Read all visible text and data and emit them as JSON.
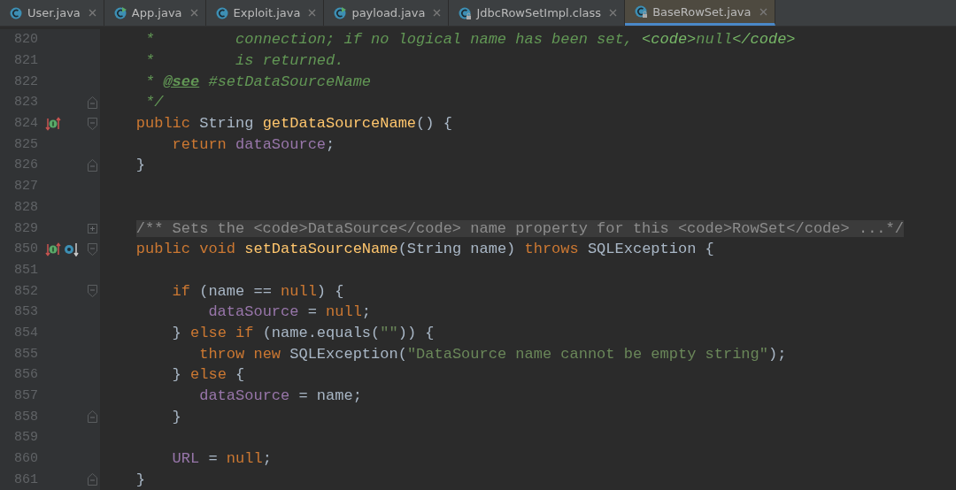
{
  "tabs": [
    {
      "label": "User.java",
      "kind": "class",
      "selected": false
    },
    {
      "label": "App.java",
      "kind": "runnable",
      "selected": false
    },
    {
      "label": "Exploit.java",
      "kind": "class",
      "selected": false
    },
    {
      "label": "payload.java",
      "kind": "runnable",
      "selected": false
    },
    {
      "label": "JdbcRowSetImpl.class",
      "kind": "compiled",
      "selected": false
    },
    {
      "label": "BaseRowSet.java",
      "kind": "compiled",
      "selected": true
    }
  ],
  "lines": [
    {
      "number": "820",
      "tokens": [
        {
          "kind": "doc",
          "text": "     *         connection; if no logical name has been set, "
        },
        {
          "kind": "tag",
          "text": "<code>"
        },
        {
          "kind": "doc",
          "text": "null"
        },
        {
          "kind": "tag",
          "text": "</code>"
        }
      ]
    },
    {
      "number": "821",
      "tokens": [
        {
          "kind": "doc",
          "text": "     *         is returned."
        }
      ]
    },
    {
      "number": "822",
      "tokens": [
        {
          "kind": "doc",
          "text": "     * "
        },
        {
          "kind": "doctag",
          "text": "@see"
        },
        {
          "kind": "doc",
          "text": " #setDataSourceName"
        }
      ]
    },
    {
      "number": "823",
      "fold": {
        "kind": "end"
      },
      "tokens": [
        {
          "kind": "doc",
          "text": "     */"
        }
      ]
    },
    {
      "number": "824",
      "fold": {
        "kind": "start"
      },
      "markers": [
        {
          "kind": "overrides"
        }
      ],
      "tokens": [
        {
          "kind": "kw",
          "text": "    public "
        },
        {
          "kind": "plain",
          "text": "String "
        },
        {
          "kind": "method",
          "text": "getDataSourceName"
        },
        {
          "kind": "plain",
          "text": "() {"
        }
      ]
    },
    {
      "number": "825",
      "tokens": [
        {
          "kind": "kw",
          "text": "        return "
        },
        {
          "kind": "field",
          "text": "dataSource"
        },
        {
          "kind": "plain",
          "text": ";"
        }
      ]
    },
    {
      "number": "826",
      "fold": {
        "kind": "end"
      },
      "tokens": [
        {
          "kind": "plain",
          "text": "    }"
        }
      ]
    },
    {
      "number": "827"
    },
    {
      "number": "828"
    },
    {
      "number": "829",
      "fold": {
        "kind": "collapsed"
      },
      "tokens": [
        {
          "kind": "folded",
          "text": "/** Sets the <code>DataSource</code> name property for this <code>RowSet</code> ...*/"
        }
      ]
    },
    {
      "number": "850",
      "fold": {
        "kind": "start"
      },
      "markers": [
        {
          "kind": "overrides"
        },
        {
          "kind": "implemented"
        }
      ],
      "tokens": [
        {
          "kind": "kw",
          "text": "    public void "
        },
        {
          "kind": "method",
          "text": "setDataSourceName"
        },
        {
          "kind": "plain",
          "text": "(String name) "
        },
        {
          "kind": "kw",
          "text": "throws "
        },
        {
          "kind": "plain",
          "text": "SQLException {"
        }
      ]
    },
    {
      "number": "851"
    },
    {
      "number": "852",
      "fold": {
        "kind": "start"
      },
      "tokens": [
        {
          "kind": "kw",
          "text": "        if "
        },
        {
          "kind": "plain",
          "text": "(name == "
        },
        {
          "kind": "kw",
          "text": "null"
        },
        {
          "kind": "plain",
          "text": ") {"
        }
      ]
    },
    {
      "number": "853",
      "tokens": [
        {
          "kind": "field",
          "text": "            dataSource"
        },
        {
          "kind": "plain",
          "text": " = "
        },
        {
          "kind": "kw",
          "text": "null"
        },
        {
          "kind": "plain",
          "text": ";"
        }
      ]
    },
    {
      "number": "854",
      "tokens": [
        {
          "kind": "plain",
          "text": "        } "
        },
        {
          "kind": "kw",
          "text": "else if "
        },
        {
          "kind": "plain",
          "text": "(name.equals("
        },
        {
          "kind": "str",
          "text": "\"\""
        },
        {
          "kind": "plain",
          "text": ")) {"
        }
      ]
    },
    {
      "number": "855",
      "tokens": [
        {
          "kind": "kw",
          "text": "           throw new "
        },
        {
          "kind": "plain",
          "text": "SQLException("
        },
        {
          "kind": "str",
          "text": "\"DataSource name cannot be empty string\""
        },
        {
          "kind": "plain",
          "text": ");"
        }
      ]
    },
    {
      "number": "856",
      "tokens": [
        {
          "kind": "plain",
          "text": "        } "
        },
        {
          "kind": "kw",
          "text": "else "
        },
        {
          "kind": "plain",
          "text": "{"
        }
      ]
    },
    {
      "number": "857",
      "tokens": [
        {
          "kind": "field",
          "text": "           dataSource"
        },
        {
          "kind": "plain",
          "text": " = name;"
        }
      ]
    },
    {
      "number": "858",
      "fold": {
        "kind": "end"
      },
      "tokens": [
        {
          "kind": "plain",
          "text": "        }"
        }
      ]
    },
    {
      "number": "859"
    },
    {
      "number": "860",
      "tokens": [
        {
          "kind": "field",
          "text": "        URL"
        },
        {
          "kind": "plain",
          "text": " = "
        },
        {
          "kind": "kw",
          "text": "null"
        },
        {
          "kind": "plain",
          "text": ";"
        }
      ]
    },
    {
      "number": "861",
      "fold": {
        "kind": "end"
      },
      "tokens": [
        {
          "kind": "plain",
          "text": "    }"
        }
      ]
    }
  ]
}
